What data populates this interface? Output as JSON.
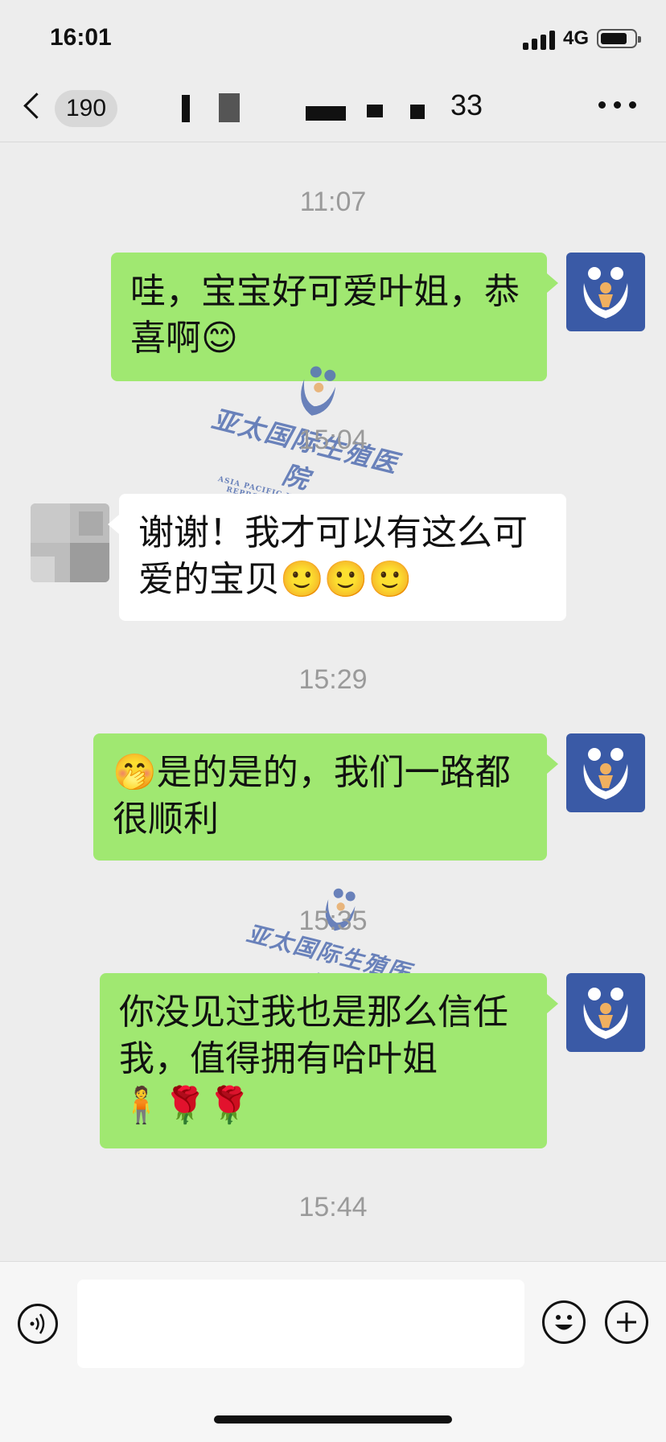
{
  "status_bar": {
    "time": "16:01",
    "network": "4G"
  },
  "nav": {
    "unread_count": "190",
    "title_visible": "33"
  },
  "messages": [
    {
      "timestamp": "11:07",
      "text": "哇，宝宝好可爱叶姐，恭喜啊😊",
      "sender": "me"
    },
    {
      "timestamp": "15:04",
      "text": "谢谢！我才可以有这么可爱的宝贝🙂🙂🙂",
      "sender": "them"
    },
    {
      "timestamp": "15:29",
      "text": "🤭是的是的，我们一路都很顺利",
      "sender": "me"
    },
    {
      "timestamp": "15:35",
      "text": "你没见过我也是那么信任我，值得拥有哈叶姐",
      "emoji_tail": "🧍🌹🌹",
      "sender": "me"
    }
  ],
  "last_timestamp": "15:44",
  "watermark": {
    "name_cn": "亚太国际生殖医院",
    "name_en": "ASIA PACIFIC INTERNATIONAL REPRODUCTIVE HOSPITAL"
  },
  "colors": {
    "my_bubble": "#a0e871",
    "their_bubble": "#ffffff",
    "hospital_avatar": "#3a5aa6",
    "background": "#ededed"
  },
  "icons": {
    "back": "chevron-left-icon",
    "more": "more-dots-icon",
    "voice": "voice-icon",
    "emoji": "emoji-icon",
    "plus": "plus-icon"
  }
}
